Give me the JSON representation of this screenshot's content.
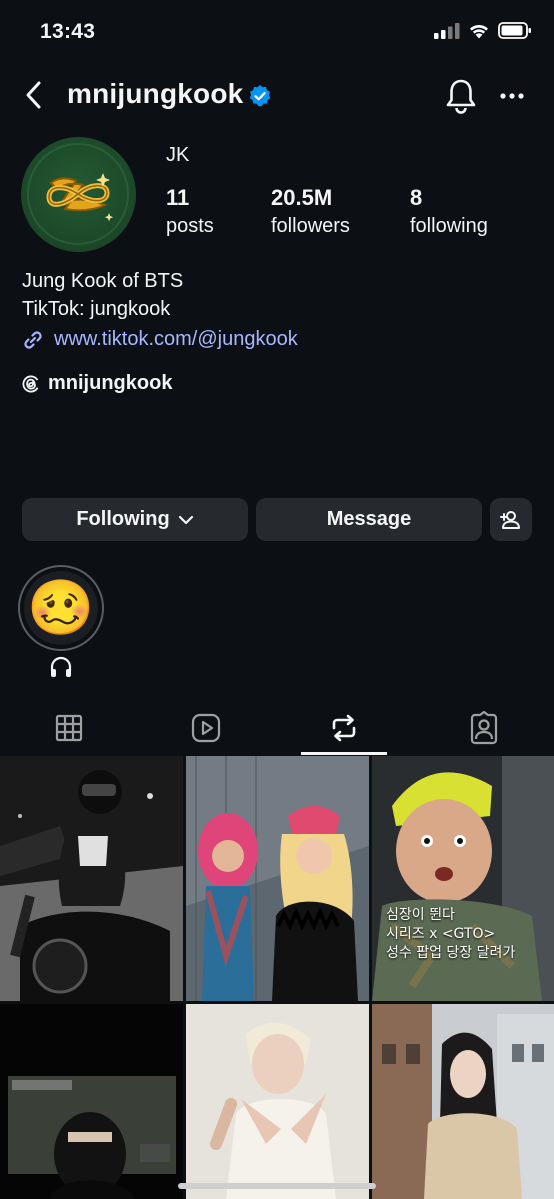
{
  "status": {
    "time": "13:43"
  },
  "header": {
    "username": "mnijungkook"
  },
  "profile": {
    "display_name": "JK",
    "stats": [
      {
        "value": "11",
        "label": "posts"
      },
      {
        "value": "20.5M",
        "label": "followers"
      },
      {
        "value": "8",
        "label": "following"
      }
    ],
    "bio_lines": [
      "Jung Kook of BTS",
      "TikTok: jungkook"
    ],
    "link": "www.tiktok.com/@jungkook",
    "threads_handle": "mnijungkook"
  },
  "actions": {
    "following_label": "Following",
    "message_label": "Message"
  },
  "highlight": {
    "emoji": "🥴"
  },
  "posts": [
    {
      "overlay": []
    },
    {
      "overlay": []
    },
    {
      "overlay": [
        "심장이 뛴다",
        "시리즈 x <GTO>",
        "성수 팝업 당장 달려가"
      ]
    },
    {
      "overlay": []
    },
    {
      "overlay": []
    },
    {
      "overlay": []
    }
  ],
  "colors": {
    "background": "#0c1014",
    "button": "#262a2f",
    "link": "#a7b7ff",
    "verified": "#0095f6"
  }
}
